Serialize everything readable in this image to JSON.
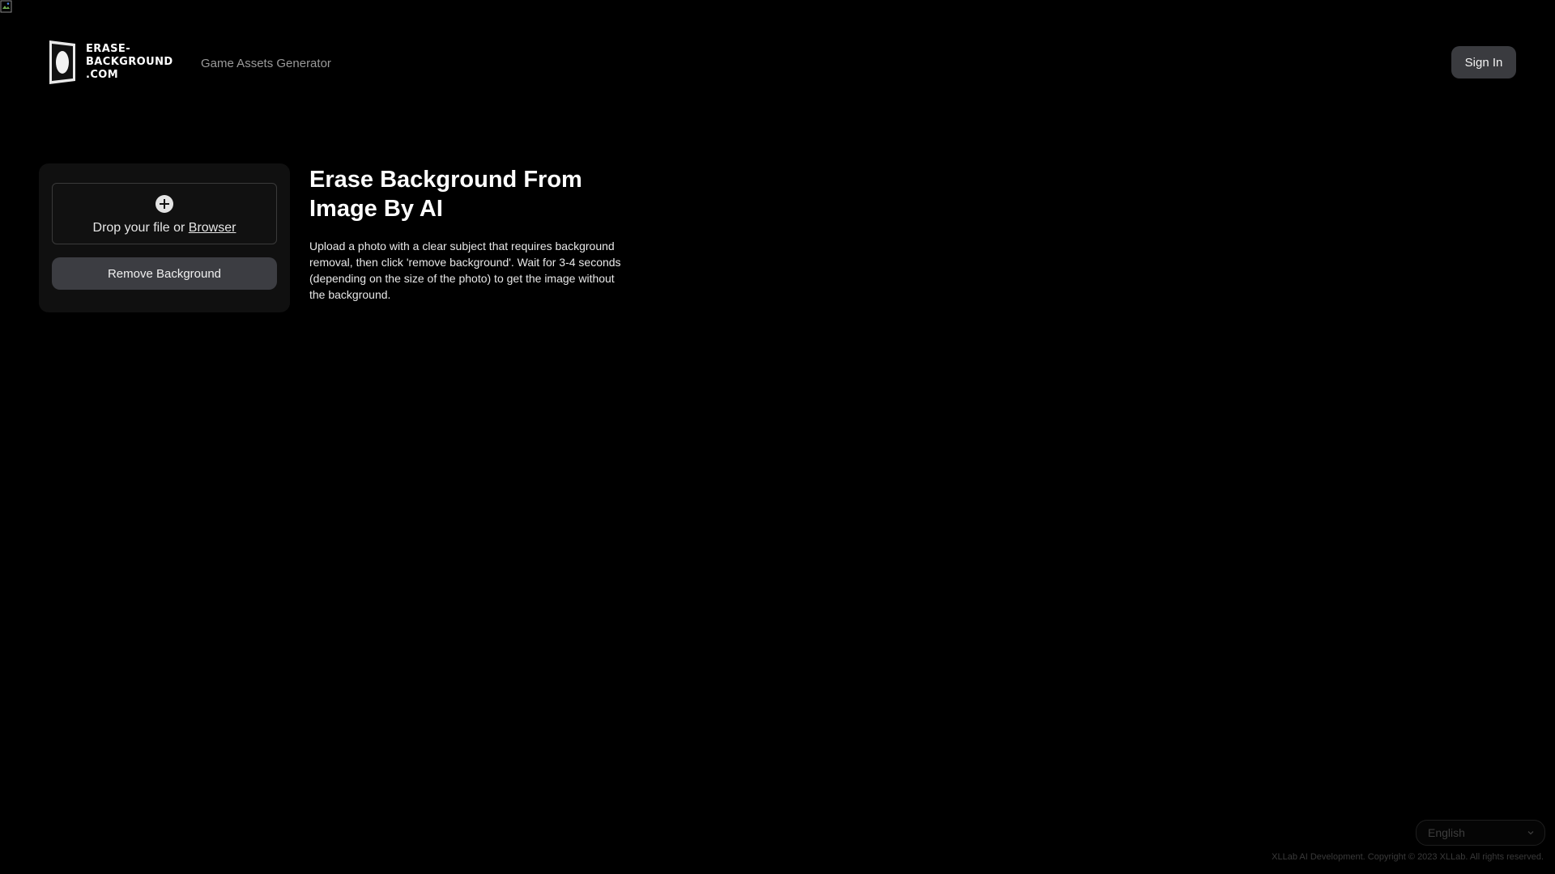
{
  "header": {
    "logo": {
      "line1": "ERASE-",
      "line2": "BACKGROUND",
      "line3": ".COM",
      "icon": "logo-mark-icon"
    },
    "nav": {
      "game_assets_label": "Game Assets Generator"
    },
    "sign_in_label": "Sign In"
  },
  "upload": {
    "add_icon": "plus-circle-icon",
    "drop_text": "Drop your file or ",
    "browser_link": "Browser",
    "remove_button": "Remove Background"
  },
  "hero": {
    "title": "Erase Background From Image By AI",
    "description": "Upload a photo with a clear subject that requires background removal, then click 'remove background'. Wait for 3-4 seconds (depending on the size of the photo) to get the image without the background."
  },
  "footer": {
    "language": "English",
    "language_icon": "chevron-down-icon",
    "copyright": "XLLab AI Development. Copyright © 2023 XLLab. All rights reserved."
  },
  "colors": {
    "background": "#000000",
    "card": "#101010",
    "button": "#3c3d42",
    "muted_text": "#9a9a9a"
  }
}
